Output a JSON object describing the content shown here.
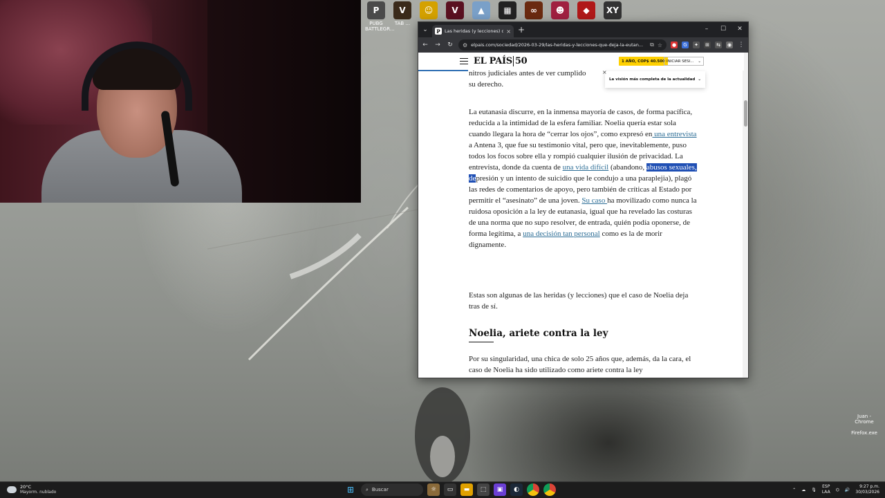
{
  "desktop_top_icons": [
    {
      "label": "PUBG BATTLEGR...",
      "icon": "pubg-icon",
      "color": "#4a4a4a",
      "glyph": "P"
    },
    {
      "label": "TAB ...",
      "icon": "v-icon",
      "color": "#3a2a1a",
      "glyph": "V"
    },
    {
      "label": "",
      "icon": "mask-icon",
      "color": "#d4a100",
      "glyph": "☺"
    },
    {
      "label": "",
      "icon": "valorant-icon",
      "color": "#5a1020",
      "glyph": "V"
    },
    {
      "label": "",
      "icon": "mountain-icon",
      "color": "#7aa0c8",
      "glyph": "▲"
    },
    {
      "label": "",
      "icon": "grid-icon",
      "color": "#222",
      "glyph": "▦"
    },
    {
      "label": "",
      "icon": "ring-icon",
      "color": "#6a2a10",
      "glyph": "∞"
    },
    {
      "label": "",
      "icon": "character-icon",
      "color": "#a02040",
      "glyph": "☻"
    },
    {
      "label": "",
      "icon": "hero-icon",
      "color": "#b01818",
      "glyph": "◆"
    },
    {
      "label": "",
      "icon": "xy-icon",
      "color": "#333",
      "glyph": "XY"
    }
  ],
  "desktop_side_icons": [
    {
      "label": "Juan - Chrome",
      "icon": "chrome-icon"
    },
    {
      "label": "Firefox.exe",
      "icon": "firefox-icon"
    }
  ],
  "browser": {
    "tab_title": "Las heridas (y lecciones) que de",
    "tab_close": "×",
    "new_tab": "+",
    "url": "elpais.com/sociedad/2026-03-29/las-heridas-y-lecciones-que-deja-la-eutan...",
    "window_buttons": {
      "minimize": "–",
      "maximize": "☐",
      "close": "✕"
    }
  },
  "site": {
    "logo": "EL PAÍS",
    "logo_anniversary": "50",
    "promo": "1 AÑO, COP$ 40.500",
    "login": "INICIAR SESI...",
    "tooltip": "La visión más completa de la actualidad"
  },
  "article": {
    "p0_line1": "nitros judiciales antes de ver cumplido",
    "p0_line2": "su derecho.",
    "p1_a": "La eutanasia discurre, en la inmensa mayoría de casos, de forma pacífica, reducida a la intimidad de la esfera familiar. Noelia quería estar sola cuando llegara la hora de “cerrar los ojos”, como expresó en",
    "p1_link1": " una entrevista ",
    "p1_b": "a Antena 3, que fue su testimonio vital, pero que, inevitablemente, puso todos los focos sobre ella y rompió cualquier ilusión de privacidad. La entrevista, donde da cuenta de ",
    "p1_link2": "una vida difícil",
    "p1_c": " (abandono, ",
    "p1_highlight": "abusos sexuales, de",
    "p1_d": "presión y un intento de suicidio que le condujo a una paraplejia), plagó las redes de comentarios de apoyo, pero también de críticas al Estado por permitir el “asesinato” de una joven. ",
    "p1_link3": "Su caso ",
    "p1_e": "ha movilizado como nunca la ruidosa oposición a la ley de eutanasia, igual que ha revelado las costuras de una norma que no supo resolver, de entrada, quién podía oponerse, de forma legítima, a ",
    "p1_link4": "una decisión tan personal",
    "p1_f": " como es la de morir dignamente.",
    "p2": "Estas son algunas de las heridas (y lecciones) que el caso de Noelia deja tras de sí.",
    "heading": "Noelia, ariete contra la ley",
    "p3": "Por su singularidad, una chica de solo 25 años que, además, da la cara, el caso de Noelia ha sido utilizado como ariete contra la ley"
  },
  "taskbar": {
    "temperature": "20°C",
    "weather": "Mayorm. nublado",
    "search_placeholder": "Buscar",
    "lang_top": "ESP",
    "lang_bottom": "LAA",
    "time": "9:27 p.m.",
    "date": "30/03/2026"
  },
  "colors": {
    "link": "#2d6e96",
    "selection": "#1f4fb4",
    "promo": "#ffd000"
  }
}
